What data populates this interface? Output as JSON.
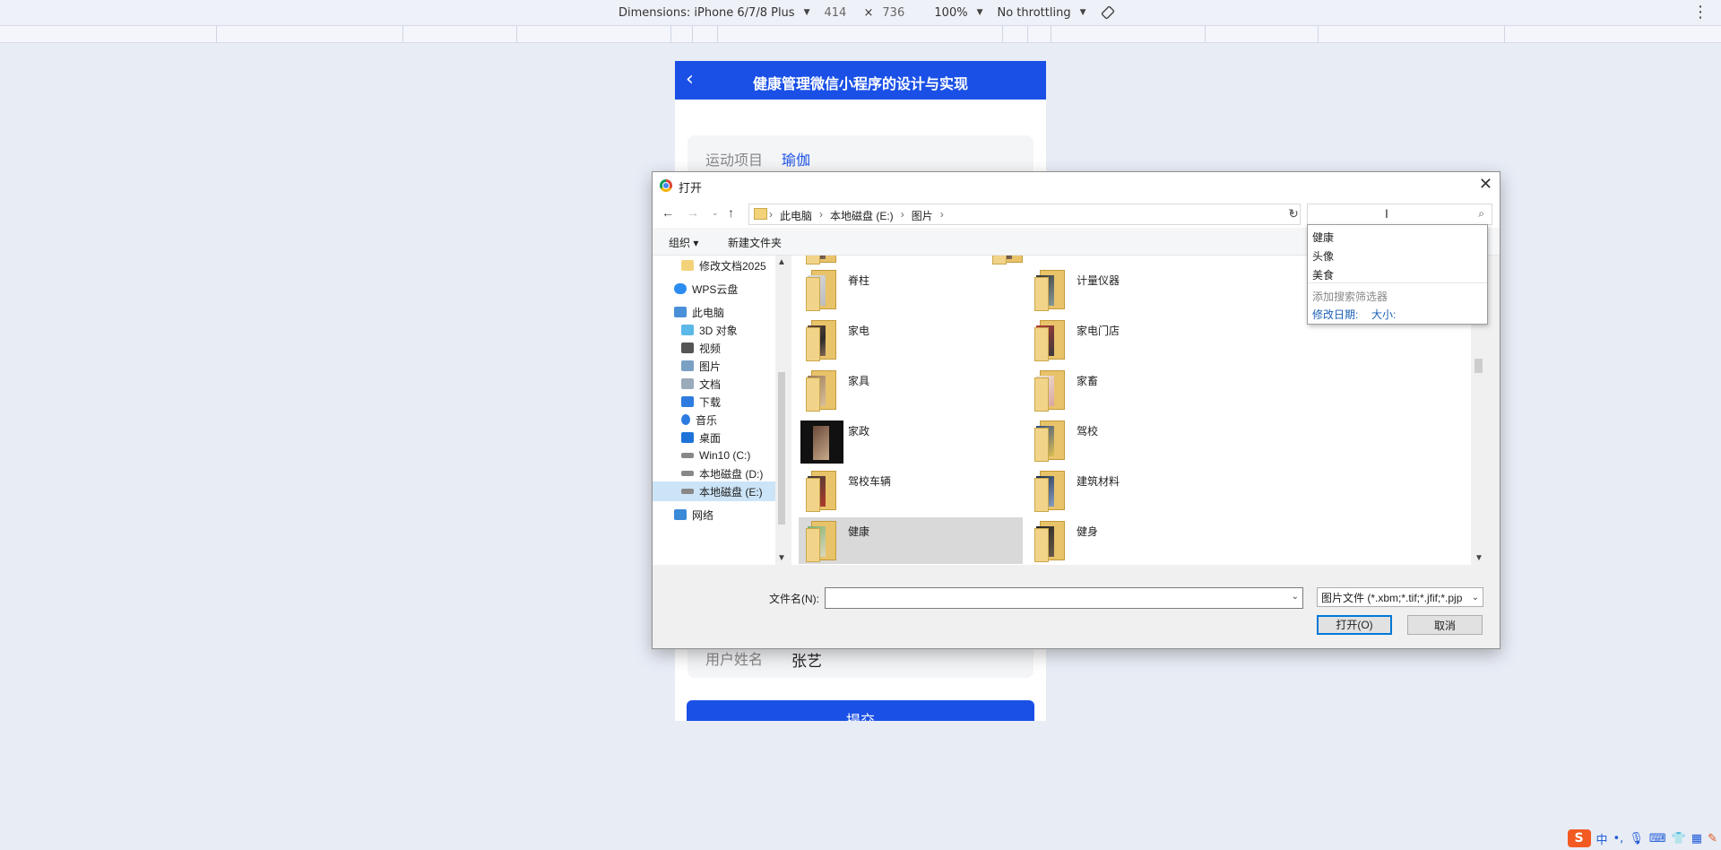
{
  "devtools": {
    "dimensions_label": "Dimensions: iPhone 6/7/8 Plus",
    "width": "414",
    "times": "×",
    "height": "736",
    "zoom": "100%",
    "throttling": "No throttling",
    "rotate_icon": "rotate-icon",
    "more_icon": "kebab-icon"
  },
  "app": {
    "title": "健康管理微信小程序的设计与实现",
    "back_icon": "chevron-left-icon",
    "fields": [
      {
        "label": "运动项目",
        "value": "瑜伽"
      },
      {
        "label": "用户姓名",
        "value": "张艺"
      }
    ],
    "submit_label": "提交"
  },
  "dialog": {
    "title": "打开",
    "close_icon": "close-icon",
    "breadcrumb": [
      "此电脑",
      "本地磁盘 (E:)",
      "图片"
    ],
    "search_value": "",
    "toolbar": {
      "organize": "组织",
      "new_folder": "新建文件夹"
    },
    "sidebar": [
      {
        "label": "修改文档2025",
        "icon": "folder-icon"
      },
      {
        "label": "WPS云盘",
        "icon": "cloud-icon"
      },
      {
        "label": "此电脑",
        "icon": "computer-icon"
      },
      {
        "label": "3D 对象",
        "icon": "3d-objects-icon"
      },
      {
        "label": "视频",
        "icon": "video-icon"
      },
      {
        "label": "图片",
        "icon": "pictures-icon"
      },
      {
        "label": "文档",
        "icon": "documents-icon"
      },
      {
        "label": "下载",
        "icon": "download-icon"
      },
      {
        "label": "音乐",
        "icon": "music-icon"
      },
      {
        "label": "桌面",
        "icon": "desktop-icon"
      },
      {
        "label": "Win10 (C:)",
        "icon": "drive-icon"
      },
      {
        "label": "本地磁盘 (D:)",
        "icon": "drive-icon"
      },
      {
        "label": "本地磁盘 (E:)",
        "icon": "drive-icon",
        "selected": true
      },
      {
        "label": "网络",
        "icon": "network-icon"
      }
    ],
    "files_left": [
      "脊柱",
      "家电",
      "家具",
      "家政",
      "驾校车辆",
      "健康"
    ],
    "files_right": [
      "计量仪器",
      "家电门店",
      "家畜",
      "驾校",
      "建筑材料",
      "健身"
    ],
    "selected_file": "健康",
    "filename_label": "文件名(N):",
    "filename_value": "",
    "filetype": "图片文件 (*.xbm;*.tif;*.jfif;*.pjp",
    "open_button": "打开(O)",
    "cancel_button": "取消"
  },
  "search_suggest": {
    "items": [
      "健康",
      "头像",
      "美食"
    ],
    "add_filter": "添加搜索筛选器",
    "filter_date": "修改日期:",
    "filter_size": "大小:"
  },
  "tray": {
    "ime": "中",
    "items": [
      "microphone-icon",
      "keyboard-icon",
      "shirt-icon",
      "grid-icon",
      "tools-icon"
    ]
  }
}
